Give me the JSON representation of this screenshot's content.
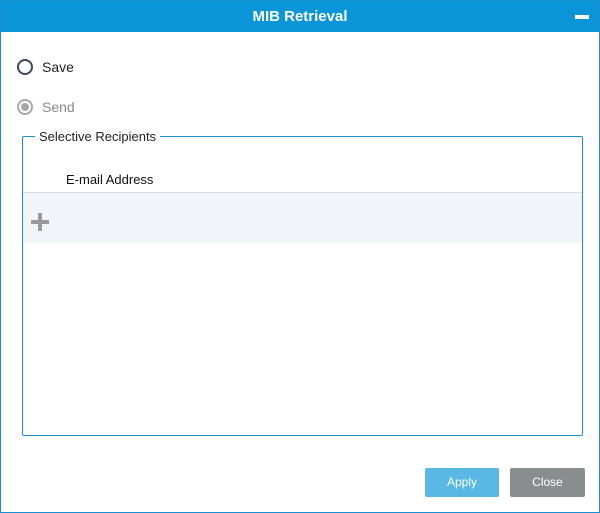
{
  "dialog": {
    "title": "MIB Retrieval"
  },
  "options": [
    {
      "label": "Save",
      "selected": false,
      "disabled": false
    },
    {
      "label": "Send",
      "selected": true,
      "disabled": true
    }
  ],
  "recipients": {
    "legend": "Selective Recipients",
    "column_header": "E-mail Address",
    "rows": []
  },
  "buttons": {
    "apply": "Apply",
    "close": "Close"
  },
  "colors": {
    "titlebar": "#0b95d9",
    "border": "#1a8fd0",
    "apply_button": "#5bb7e4",
    "close_button": "#8a8d90"
  },
  "icons": {
    "minimize": "minimize-icon",
    "add": "plus-icon"
  }
}
